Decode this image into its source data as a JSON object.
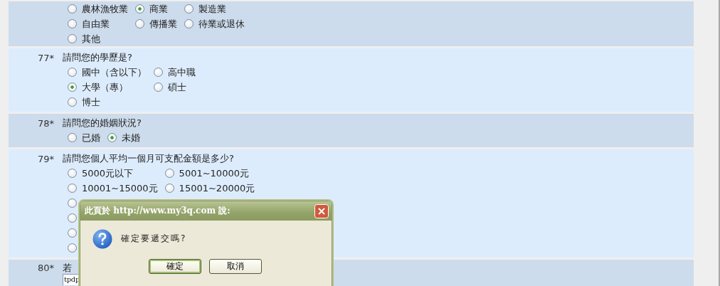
{
  "questions": [
    {
      "options": [
        [
          {
            "label": "農林漁牧業",
            "selected": false
          },
          {
            "label": "商業",
            "selected": true
          },
          {
            "label": "製造業",
            "selected": false
          }
        ],
        [
          {
            "label": "自由業",
            "selected": false
          },
          {
            "label": "傳播業",
            "selected": false
          },
          {
            "label": "待業或退休",
            "selected": false
          }
        ],
        [
          {
            "label": "其他",
            "selected": false
          }
        ]
      ]
    },
    {
      "number": "77*",
      "text": "請問您的學歷是?",
      "options": [
        [
          {
            "label": "國中（含以下）",
            "selected": false
          },
          {
            "label": "高中職",
            "selected": false
          }
        ],
        [
          {
            "label": "大學（專）",
            "selected": true
          },
          {
            "label": "碩士",
            "selected": false
          }
        ],
        [
          {
            "label": "博士",
            "selected": false
          }
        ]
      ]
    },
    {
      "number": "78*",
      "text": "請問您的婚姻狀況?",
      "options": [
        [
          {
            "label": "已婚",
            "selected": false
          },
          {
            "label": "未婚",
            "selected": true
          }
        ]
      ]
    },
    {
      "number": "79*",
      "text": "請問您個人平均一個月可支配金額是多少?",
      "options": [
        [
          {
            "label": "5000元以下",
            "selected": false
          },
          {
            "label": "5001~10000元",
            "selected": false
          }
        ],
        [
          {
            "label": "10001~15000元",
            "selected": false
          },
          {
            "label": "15001~20000元",
            "selected": false
          }
        ],
        [
          {
            "selected": false
          }
        ],
        [
          {
            "selected": false
          }
        ],
        [
          {
            "selected": false
          }
        ],
        [
          {
            "selected": false
          }
        ]
      ]
    },
    {
      "number": "80*",
      "text": "若",
      "input": {
        "value": "tpdp"
      }
    }
  ],
  "dialog": {
    "title": "此頁於 http://www.my3q.com 說:",
    "message": "確定要遞交嗎?",
    "buttons": [
      {
        "label": "確定",
        "focused": true
      },
      {
        "label": "取消",
        "focused": false
      }
    ]
  }
}
